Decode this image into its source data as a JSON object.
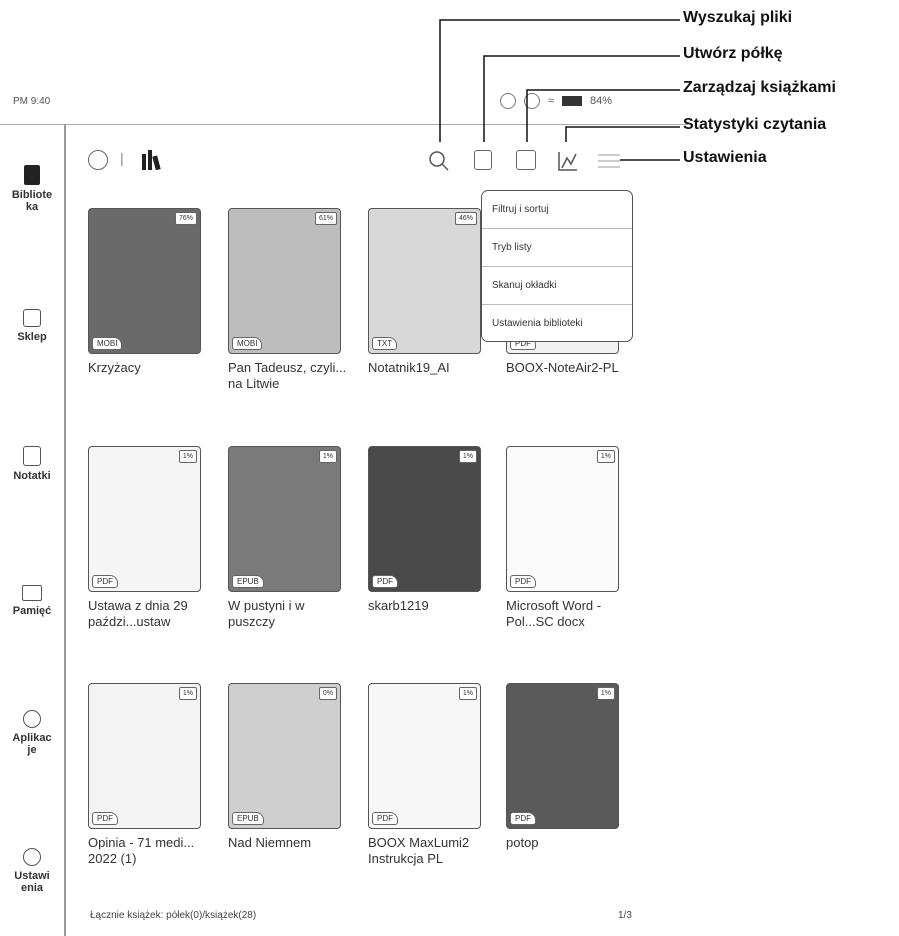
{
  "status": {
    "time": "PM 9:40",
    "battery": "84%"
  },
  "callouts": [
    "Wyszukaj pliki",
    "Utwórz półkę",
    "Zarządzaj książkami",
    "Statystyki czytania",
    "Ustawienia"
  ],
  "sidebar": {
    "items": [
      {
        "label": "Bibliote ka",
        "icon": "book-icon"
      },
      {
        "label": "Sklep",
        "icon": "store-icon"
      },
      {
        "label": "Notatki",
        "icon": "notes-icon"
      },
      {
        "label": "Pamięć",
        "icon": "folder-icon"
      },
      {
        "label": "Aplikac je",
        "icon": "apps-icon"
      },
      {
        "label": "Ustawi enia",
        "icon": "settings-icon"
      }
    ]
  },
  "toolbar": {
    "separator": "|"
  },
  "menu": {
    "items": [
      "Filtruj i sortuj",
      "Tryb listy",
      "Skanuj okładki",
      "Ustawienia biblioteki"
    ]
  },
  "books": [
    {
      "title": "Krzyżacy",
      "format": "MOBI",
      "progress": "76%"
    },
    {
      "title": "Pan Tadeusz, czyli... na Litwie",
      "format": "MOBI",
      "progress": "61%"
    },
    {
      "title": "Notatnik19_AI",
      "format": "TXT",
      "progress": "46%"
    },
    {
      "title": "BOOX-NoteAir2-PL",
      "format": "PDF",
      "progress": ""
    },
    {
      "title": "Ustawa z dnia 29 paździ...ustaw",
      "format": "PDF",
      "progress": "1%"
    },
    {
      "title": "W pustyni i w puszczy",
      "format": "EPUB",
      "progress": "1%"
    },
    {
      "title": "skarb1219",
      "format": "PDF",
      "progress": "1%"
    },
    {
      "title": "Microsoft Word - Pol...SC docx",
      "format": "PDF",
      "progress": "1%"
    },
    {
      "title": "Opinia - 71 medi... 2022 (1)",
      "format": "PDF",
      "progress": "1%"
    },
    {
      "title": "Nad Niemnem",
      "format": "EPUB",
      "progress": "0%"
    },
    {
      "title": "BOOX MaxLumi2 Instrukcja PL",
      "format": "PDF",
      "progress": "1%"
    },
    {
      "title": "potop",
      "format": "PDF",
      "progress": "1%"
    }
  ],
  "footer": {
    "summary": "Łącznie książek: półek(0)/książek(28)",
    "page": "1/3"
  }
}
